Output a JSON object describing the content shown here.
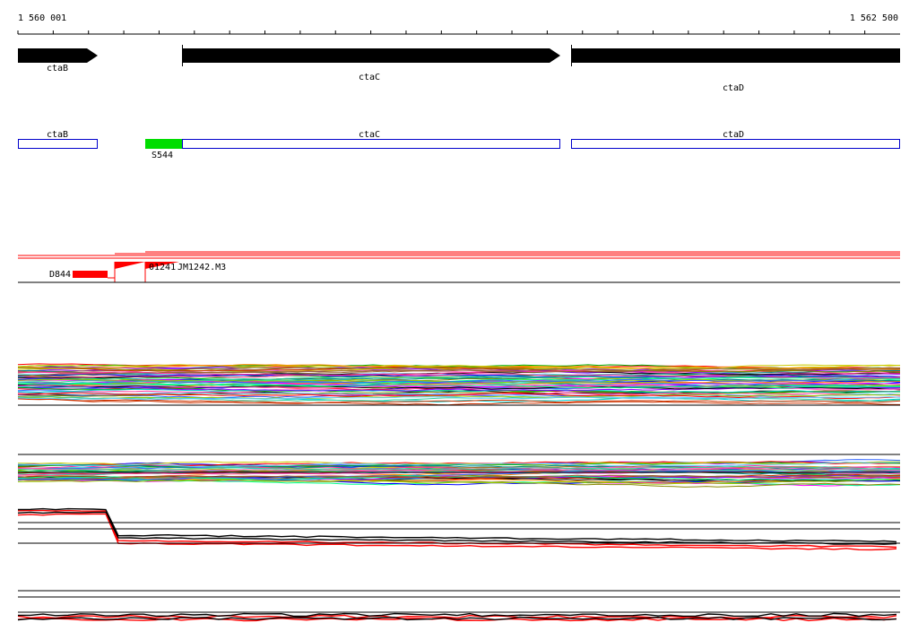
{
  "ruler": {
    "start_label": "1 560 001",
    "end_label": "1 562 500"
  },
  "genes": [
    {
      "name": "ctaB"
    },
    {
      "name": "ctaC"
    },
    {
      "name": "ctaD"
    }
  ],
  "cds": [
    {
      "name": "ctaB"
    },
    {
      "name": "ctaC"
    },
    {
      "name": "ctaD"
    }
  ],
  "feature": {
    "name": "S544",
    "color": "#00dd00"
  },
  "transcripts": {
    "color": "#ff0000",
    "labels": {
      "left": "D844",
      "mid": "01241",
      "right": "JM1242.M3"
    }
  },
  "colors": {
    "cds_outline": "#0000cc",
    "gene_fill": "#000000"
  }
}
